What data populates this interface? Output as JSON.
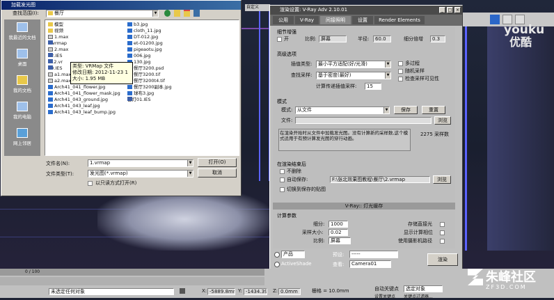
{
  "open_dialog": {
    "title": "加载发光图",
    "lookin_label": "查找范围(I):",
    "lookin_value": "餐厅",
    "sidebar": [
      {
        "label": "我最近的文档"
      },
      {
        "label": "桌面"
      },
      {
        "label": "我的文档"
      },
      {
        "label": "我的电脑"
      },
      {
        "label": "网上邻居"
      }
    ],
    "files_col1": [
      {
        "name": "模型",
        "type": "folder"
      },
      {
        "name": "视频",
        "type": "folder"
      },
      {
        "name": "1.max",
        "type": "max"
      },
      {
        "name": "1.vrmap",
        "type": "file"
      },
      {
        "name": "2.max",
        "type": "max"
      },
      {
        "name": "12.IES",
        "type": "file"
      },
      {
        "name": "012.vr",
        "type": "file"
      },
      {
        "name": "20.IES",
        "type": "file"
      },
      {
        "name": "a1.max",
        "type": "max"
      },
      {
        "name": "a2.max",
        "type": "max"
      },
      {
        "name": "Arch41_041_flower.jpg",
        "type": "img"
      },
      {
        "name": "Arch41_041_flower_mask.jpg",
        "type": "img"
      },
      {
        "name": "Arch41_043_ground.jpg",
        "type": "img"
      },
      {
        "name": "Arch41_043_leaf.jpg",
        "type": "img"
      },
      {
        "name": "Arch41_043_leaf_bump.jpg",
        "type": "img"
      }
    ],
    "files_col2": [
      {
        "name": "b3.jpg",
        "type": "img"
      },
      {
        "name": "cloth_11.jpg",
        "type": "img"
      },
      {
        "name": "DT-012.jpg",
        "type": "img"
      },
      {
        "name": "et-01200.jpg",
        "type": "img"
      },
      {
        "name": "pigeaotu.jpg",
        "type": "img"
      },
      {
        "name": "006.jpg",
        "type": "img"
      },
      {
        "name": "130.jpg",
        "type": "img"
      },
      {
        "name": "餐厅3200.psd",
        "type": "img"
      },
      {
        "name": "餐厅3200.tif",
        "type": "img"
      },
      {
        "name": "餐厅3200t4.tif",
        "type": "img"
      },
      {
        "name": "餐厅3200副本.jpg",
        "type": "img"
      },
      {
        "name": "球布3.jpg",
        "type": "img"
      },
      {
        "name": "台灯01.IES",
        "type": "file"
      }
    ],
    "tooltip": {
      "line1": "类型: VRMap 文件",
      "line2": "修改日期: 2012-11-23 1",
      "line3": "大小: 1.95 MB"
    },
    "filename_label": "文件名(N):",
    "filename_value": "1.vrmap",
    "filetype_label": "文件类型(T):",
    "filetype_value": "发光图(*.vrmap)",
    "readonly_label": "以只读方式打开(R)",
    "open_button": "打开(O)",
    "cancel_button": "取消"
  },
  "render_dialog": {
    "title": "渲染设置: V-Ray Adv 2.10.01",
    "tabs": [
      "公用",
      "V-Ray",
      "间接照明",
      "设置",
      "Render Elements"
    ],
    "detail": {
      "title": "细节增强",
      "on_label": "开",
      "scale_label": "比例:",
      "scale_value": "屏幕",
      "radius_label": "半径:",
      "radius_value": "60.0",
      "subdiv_label": "细分倍增",
      "subdiv_value": "0.3"
    },
    "advanced": {
      "title": "高级选项",
      "interp_label": "插值类型:",
      "interp_value": "最小平方适配(好/光滑)",
      "lookup_label": "查找采样:",
      "lookup_value": "基于密度(最好)",
      "calc_label": "计算传递插值采样:",
      "calc_value": "15",
      "multipass_label": "多过程",
      "random_label": "随机采样",
      "visibility_label": "检查采样可见性"
    },
    "mode": {
      "title": "模式",
      "mode_label": "模式:",
      "mode_value": "从文件",
      "save_button": "保存",
      "reset_button": "重置",
      "file_label": "文件:",
      "browse_button": "浏览",
      "desc": "在渲染开始时从文件中加载发光图。没有计算新的采样数,这个模式适用于有预计算发光图的穿行动画。",
      "samples": "2275 采样数"
    },
    "after_render": {
      "title": "在渲染结束后",
      "nodelete_label": "不删除",
      "autosave_label": "自动保存:",
      "autosave_value": "F:\\张北效果图教程\\餐厅\\2.vrmap",
      "browse_button": "浏览",
      "switch_label": "切换到保存的贴图"
    },
    "rollout_lightcache": "V-Ray:: 灯光缓存",
    "calc_params": {
      "title": "计算参数",
      "subdiv_label": "细分:",
      "subdiv_value": "1000",
      "sample_label": "采样大小:",
      "sample_value": "0.02",
      "scale_label": "比例:",
      "scale_value": "屏幕",
      "store_label": "存储直接光",
      "show_label": "显示计算相位",
      "camera_label": "使用摄影机路径"
    },
    "bottom": {
      "product_label": "产品",
      "activeshade_label": "ActiveShade",
      "preset_label": "预设:",
      "preset_value": "-----",
      "view_label": "查看:",
      "view_value": "Camera01",
      "render_button": "渲染"
    }
  },
  "statusbar": {
    "frame": "0 / 100",
    "selection": "未选定任何对象",
    "x_label": "X:",
    "x_value": "-5889.8mm",
    "y_label": "Y:",
    "y_value": "-1434.39mm",
    "z_label": "Z:",
    "z_value": "0.0mm",
    "grid": "栅格 = 10.0mm",
    "autokey": "自动关键点",
    "selected": "选定对象",
    "setkey": "设置关键点",
    "keyfilter": "关键点过滤器..."
  },
  "watermarks": {
    "youku_latin": "youku",
    "youku_cn": "优酷",
    "zhufeng": "朱峰社区",
    "site": "ZF3D.COM"
  },
  "colors": {
    "accent": "#0a246a",
    "vline": "#5b63ff"
  }
}
